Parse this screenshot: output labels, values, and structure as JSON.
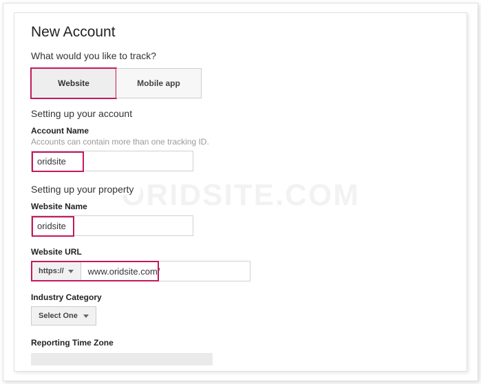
{
  "watermark": "ORIDSITE.COM",
  "header": {
    "title": "New Account",
    "prompt": "What would you like to track?"
  },
  "tabs": {
    "website": "Website",
    "mobile": "Mobile app"
  },
  "account": {
    "section_title": "Setting up your account",
    "name_label": "Account Name",
    "name_hint": "Accounts can contain more than one tracking ID.",
    "name_value": "oridsite"
  },
  "property": {
    "section_title": "Setting up your property",
    "website_name_label": "Website Name",
    "website_name_value": "oridsite",
    "website_url_label": "Website URL",
    "scheme": "https://",
    "url_value": "www.oridsite.com/",
    "industry_label": "Industry Category",
    "industry_select": "Select One",
    "timezone_label": "Reporting Time Zone"
  }
}
